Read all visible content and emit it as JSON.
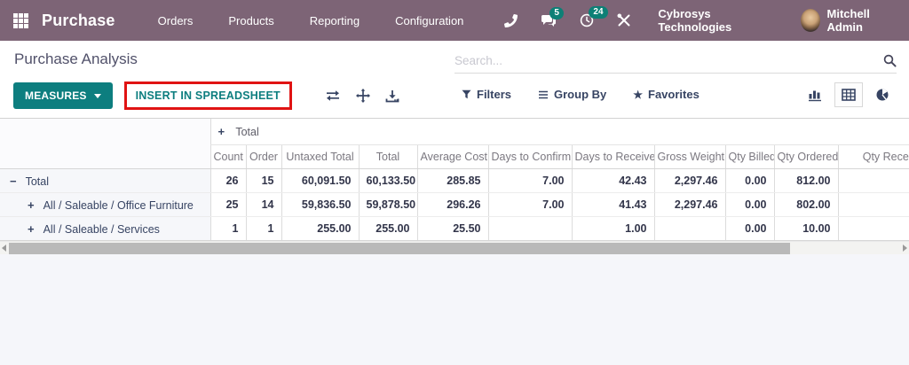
{
  "navbar": {
    "brand": "Purchase",
    "menus": [
      "Orders",
      "Products",
      "Reporting",
      "Configuration"
    ],
    "badges": {
      "messages": "5",
      "activities": "24"
    },
    "company": "Cybrosys Technologies",
    "user": "Mitchell Admin",
    "icons": {
      "apps": "grid-3x3",
      "phone": "phone-handset",
      "messages": "chat-bubble",
      "activities": "clock",
      "debug": "crossed-tools"
    },
    "colors": {
      "background": "#7d6476",
      "badge": "#0d8076"
    }
  },
  "control_panel": {
    "title": "Purchase Analysis",
    "search_placeholder": "Search...",
    "measures_label": "MEASURES",
    "insert_label": "INSERT IN SPREADSHEET",
    "filters_label": "Filters",
    "group_by_label": "Group By",
    "favorites_label": "Favorites",
    "icons": {
      "search": "magnifier",
      "flip_axis": "swap-arrows",
      "expand_all": "move-cross",
      "download": "download-tray",
      "filters": "funnel",
      "group_by": "list-lines",
      "favorites": "star",
      "bar_chart_view": "bar-chart",
      "pivot_view": "table-grid",
      "dashboard_view": "pie-chart"
    },
    "colors": {
      "accent_teal": "#0d7e7f",
      "highlight_red": "#e01313",
      "text_dark": "#374463"
    }
  },
  "pivot": {
    "col_group_expander": "+",
    "col_group_header": "Total",
    "columns": [
      "Count",
      "Order",
      "Untaxed Total",
      "Total",
      "Average Cost",
      "Days to Confirm",
      "Days to Receive",
      "Gross Weight",
      "Qty Billed",
      "Qty Ordered",
      "Qty Received"
    ],
    "rows": [
      {
        "label": "Total",
        "expander": "minus",
        "indent": 0,
        "values": [
          "26",
          "15",
          "60,091.50",
          "60,133.50",
          "285.85",
          "7.00",
          "42.43",
          "2,297.46",
          "0.00",
          "812.00",
          ""
        ]
      },
      {
        "label": "All / Saleable / Office Furniture",
        "expander": "plus",
        "indent": 1,
        "values": [
          "25",
          "14",
          "59,836.50",
          "59,878.50",
          "296.26",
          "7.00",
          "41.43",
          "2,297.46",
          "0.00",
          "802.00",
          ""
        ]
      },
      {
        "label": "All / Saleable / Services",
        "expander": "plus",
        "indent": 1,
        "values": [
          "1",
          "1",
          "255.00",
          "255.00",
          "25.50",
          "",
          "1.00",
          "",
          "0.00",
          "10.00",
          ""
        ]
      }
    ]
  }
}
